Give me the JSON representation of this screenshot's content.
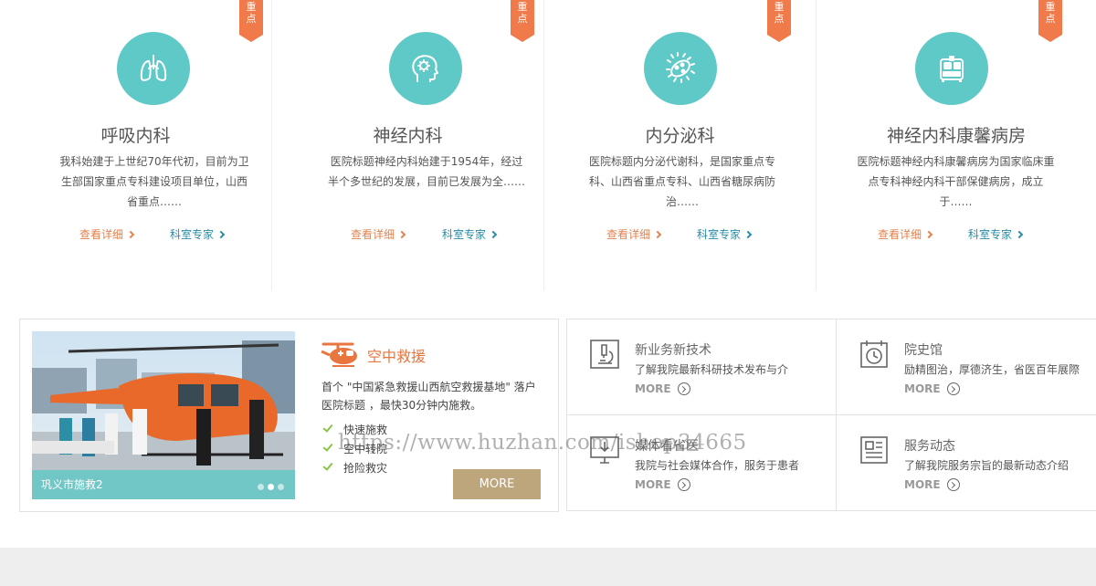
{
  "departments": [
    {
      "badge": "重点",
      "title": "呼吸内科",
      "desc": "我科始建于上世纪70年代初，目前为卫生部国家重点专科建设项目单位，山西省重点……",
      "detail_label": "查看详细",
      "expert_label": "科室专家",
      "icon": "lungs-icon"
    },
    {
      "badge": "重点",
      "title": "神经内科",
      "desc": "医院标题神经内科始建于1954年，经过半个多世纪的发展，目前已发展为全……",
      "detail_label": "查看详细",
      "expert_label": "科室专家",
      "icon": "brain-head-icon"
    },
    {
      "badge": "重点",
      "title": "内分泌科",
      "desc": "医院标题内分泌代谢科，是国家重点专科、山西省重点专科、山西省糖尿病防治……",
      "detail_label": "查看详细",
      "expert_label": "科室专家",
      "icon": "virus-icon"
    },
    {
      "badge": "重点",
      "title": "神经内科康馨病房",
      "desc": "医院标题神经内科康馨病房为国家临床重点专科神经内科干部保健病房，成立于……",
      "detail_label": "查看详细",
      "expert_label": "科室专家",
      "icon": "hospital-bed-icon"
    }
  ],
  "rescue": {
    "title": "空中救援",
    "desc": "首个 \"中国紧急救援山西航空救援基地\" 落户医院标题 ，最快30分钟内施救。",
    "features": [
      "快速施救",
      "空中转院",
      "抢险救灾"
    ],
    "more_label": "MORE",
    "slide_caption": "巩义市施救2",
    "slide_count": 3,
    "active_slide": 2
  },
  "info": [
    {
      "title": "新业务新技术",
      "desc": "了解我院最新科研技术发布与介",
      "more": "MORE",
      "icon": "microscope-icon"
    },
    {
      "title": "院史馆",
      "desc": "励精图治，厚德济生，省医百年展際",
      "more": "MORE",
      "icon": "calendar-clock-icon"
    },
    {
      "title": "媒体看省医",
      "desc": "我院与社会媒体合作，服务于患者",
      "more": "MORE",
      "icon": "monitor-download-icon"
    },
    {
      "title": "服务动态",
      "desc": "了解我院服务宗旨的最新动态介绍",
      "more": "MORE",
      "icon": "newspaper-icon"
    }
  ],
  "watermark": "https://www.huzhan.com/ishop34665",
  "colors": {
    "accent_teal": "#5ec9c6",
    "accent_orange": "#f07a4a",
    "link_expert": "#2a8ca8",
    "more_button": "#bda57c"
  }
}
